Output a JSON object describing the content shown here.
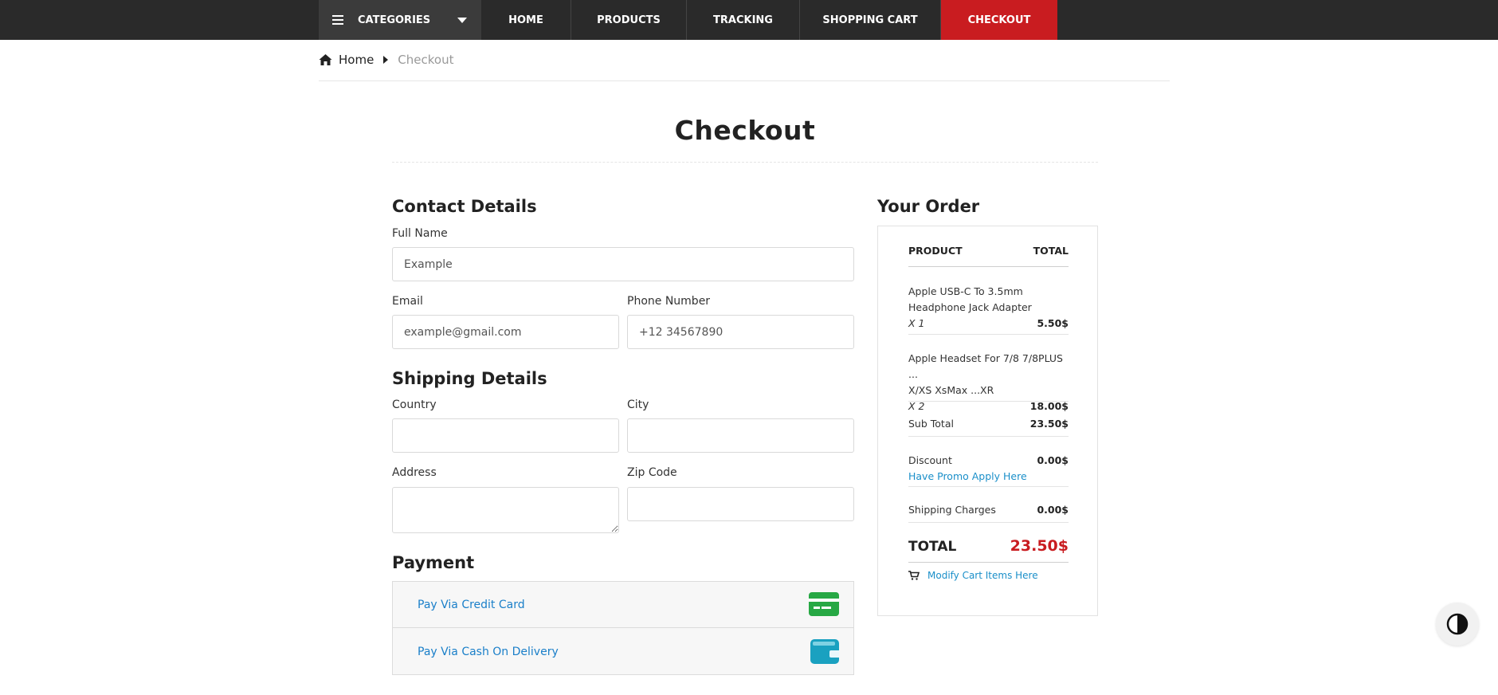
{
  "nav": {
    "categories": "CATEGORIES",
    "links": [
      "HOME",
      "PRODUCTS",
      "TRACKING",
      "SHOPPING CART",
      "CHECKOUT"
    ],
    "active": "CHECKOUT",
    "active_color": "#c91c20"
  },
  "breadcrumb": {
    "home": "Home",
    "current": "Checkout"
  },
  "page_title": "Checkout",
  "contact": {
    "heading": "Contact Details",
    "full_name_label": "Full Name",
    "full_name_placeholder": "Example",
    "email_label": "Email",
    "email_placeholder": "example@gmail.com",
    "phone_label": "Phone Number",
    "phone_placeholder": "+12 34567890"
  },
  "shipping": {
    "heading": "Shipping Details",
    "country_label": "Country",
    "city_label": "City",
    "address_label": "Address",
    "zip_label": "Zip Code"
  },
  "payment": {
    "heading": "Payment",
    "credit_card": "Pay Via Credit Card",
    "cash": "Pay Via Cash On Delivery",
    "credit_icon": "credit-card-icon",
    "cash_icon": "wallet-icon"
  },
  "order": {
    "heading": "Your Order",
    "col_product": "PRODUCT",
    "col_total": "TOTAL",
    "items": [
      {
        "name_line1": "Apple USB-C To 3.5mm",
        "name_line2": "Headphone Jack Adapter",
        "qty": "X 1",
        "price": "5.50$"
      },
      {
        "name_line1": "Apple Headset For 7/8 7/8PLUS ...",
        "name_line2": "X/XS XsMax ...XR",
        "qty": "X 2",
        "price": "18.00$"
      }
    ],
    "subtotal_label": "Sub Total",
    "subtotal": "23.50$",
    "discount_label": "Discount",
    "discount": "0.00$",
    "promo_link": "Have Promo Apply Here",
    "shipping_label": "Shipping Charges",
    "shipping": "0.00$",
    "total_label": "TOTAL",
    "total": "23.50$",
    "modify_link": "Modify Cart Items Here"
  }
}
